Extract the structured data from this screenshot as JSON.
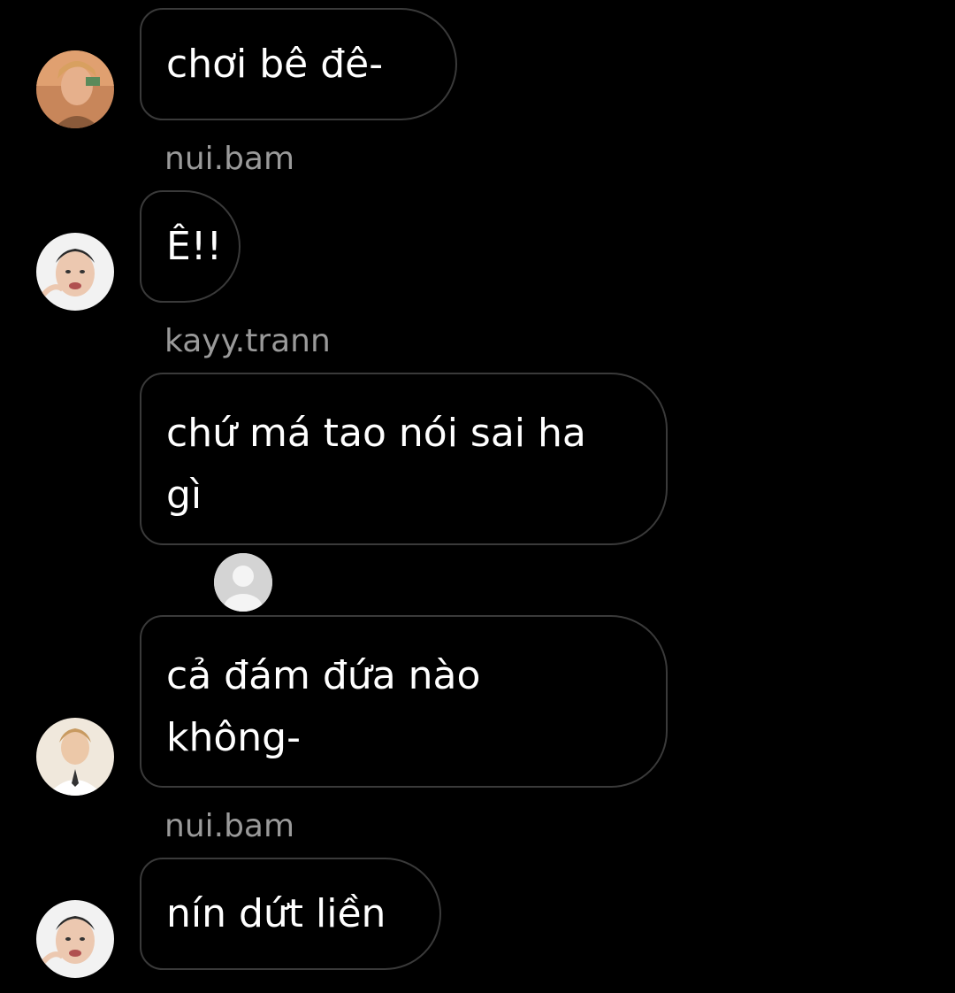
{
  "messages": [
    {
      "sender": "",
      "text": "chơi bê đê-",
      "avatar": "avatar-orange-hair"
    },
    {
      "sender": "nui.bam",
      "text": "Ê!!",
      "avatar": "avatar-face-closeup"
    },
    {
      "sender": "kayy.trann",
      "text": "chứ má tao nói sai ha gì",
      "avatar": ""
    },
    {
      "sender": "",
      "text": "cả đám đứa nào không-",
      "avatar": "avatar-white-shirt"
    },
    {
      "sender": "nui.bam",
      "text": "nín dứt liền",
      "avatar": "avatar-face-closeup"
    }
  ],
  "colors": {
    "background": "#000000",
    "bubble_border": "#3a3a3a",
    "sender_text": "#9a9a9a",
    "message_text": "#ffffff"
  }
}
